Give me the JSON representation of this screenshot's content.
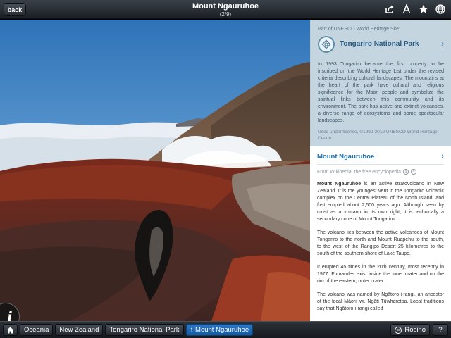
{
  "header": {
    "back_label": "back",
    "title": "Mount Ngauruhoe",
    "subtitle": "(2/9)"
  },
  "photo": {
    "info_label": "i"
  },
  "unesco": {
    "part_of": "Part of UNESCO World Heritage Site:",
    "site_name": "Tongariro National Park",
    "description": "In 1993 Tongariro became the first property to be inscribed on the World Heritage List under the revised criteria describing cultural landscapes. The mountains at the heart of the park have cultural and religious significance for the Maori people and symbolize the spiritual links between this community and its environment. The park has active and extinct volcanoes, a diverse range of ecosystems and some spectacular landscapes.",
    "credit": "Used under license, ©1992-2010 UNESCO World Heritage Centre"
  },
  "wiki": {
    "title": "Mount Ngauruhoe",
    "source": "From Wikipedia, the free encyclopedia",
    "p1_bold": "Mount Ngauruhoe",
    "p1_rest": " is an active stratovolcano in New Zealand. It is the youngest vent in the Tongariro volcanic complex on the Central Plateau of the North Island, and first erupted about 2,500 years ago. Although seen by most as a volcano in its own right, it is technically a secondary cone of Mount Tongariro.",
    "p2": "The volcano lies between the active volcanoes of Mount Tongariro to the north and Mount Ruapehu to the south, to the west of the Rangipo Desert 25 kilometres to the south of the southern shore of Lake Taupo.",
    "p3": "It erupted 45 times in the 20th century, most recently in 1977. Fumaroles exist inside the inner crater and on the rim of the eastern, outer crater.",
    "p4": "The volcano was named by Ngātoro-i-rangi, an ancestor of the local Māori iwi, Ngāti Tūwharetoa. Local traditions say that Ngātoro-i-rangi called"
  },
  "breadcrumbs": [
    "Oceania",
    "New Zealand",
    "Tongariro National Park",
    "↑ Mount Ngauruhoe"
  ],
  "bottom": {
    "author": "Rosino",
    "help": "?"
  },
  "icons": [
    "share-icon",
    "font-size-icon",
    "favorite-star-icon",
    "globe-icon",
    "home-icon",
    "info-icon",
    "unesco-logo-icon",
    "chevron-right-icon",
    "creative-commons-icon"
  ]
}
